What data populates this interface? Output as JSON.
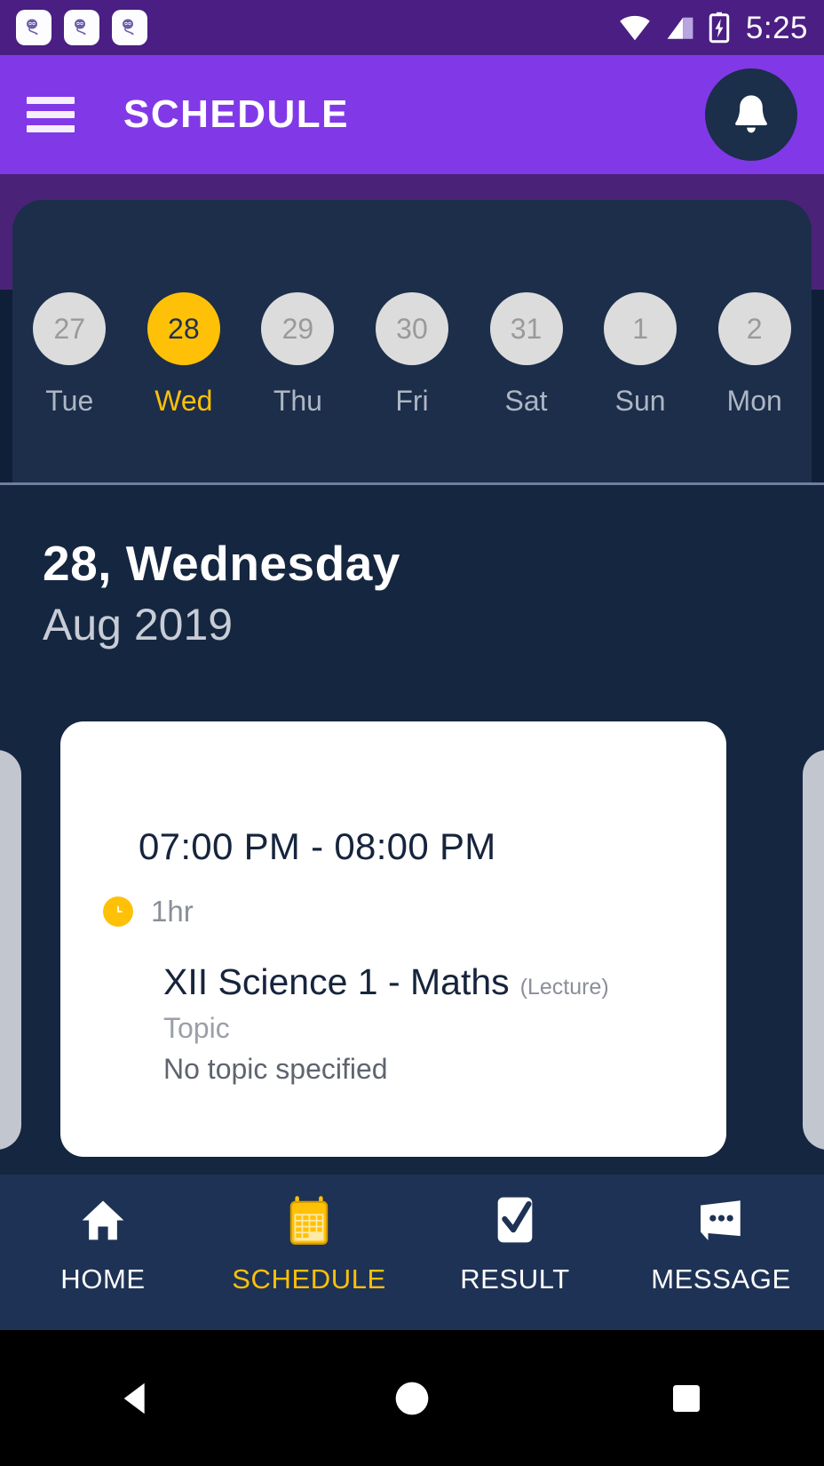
{
  "status_bar": {
    "time": "5:25",
    "notification_icons": [
      "app-notification-icon",
      "app-notification-icon",
      "app-notification-icon"
    ],
    "wifi_icon": "wifi-icon",
    "signal_icon": "cellular-signal-icon",
    "battery_icon": "battery-charging-icon",
    "background_color": "#4A1E83"
  },
  "app_bar": {
    "menu_icon": "hamburger-menu-icon",
    "title": "SCHEDULE",
    "notification_icon": "bell-icon",
    "background_color": "#8139E8"
  },
  "date_strip": {
    "days": [
      {
        "date": "27",
        "weekday": "Tue",
        "selected": false
      },
      {
        "date": "28",
        "weekday": "Wed",
        "selected": true
      },
      {
        "date": "29",
        "weekday": "Thu",
        "selected": false
      },
      {
        "date": "30",
        "weekday": "Fri",
        "selected": false
      },
      {
        "date": "31",
        "weekday": "Sat",
        "selected": false
      },
      {
        "date": "1",
        "weekday": "Sun",
        "selected": false
      },
      {
        "date": "2",
        "weekday": "Mon",
        "selected": false
      }
    ],
    "selected_color": "#FFC107",
    "inactive_circle_color": "#DCDCDC"
  },
  "heading": {
    "day_line": "28, Wednesday",
    "month_line": "Aug 2019"
  },
  "event_card": {
    "time_range": "07:00 PM - 08:00 PM",
    "duration_icon": "clock-icon",
    "duration": "1hr",
    "subject": "XII Science 1 - Maths",
    "session_type": "(Lecture)",
    "topic_label": "Topic",
    "topic_value": "No topic specified"
  },
  "bottom_nav": {
    "items": [
      {
        "label": "HOME",
        "icon": "home-icon",
        "active": false
      },
      {
        "label": "SCHEDULE",
        "icon": "calendar-icon",
        "active": true
      },
      {
        "label": "RESULT",
        "icon": "result-check-icon",
        "active": false
      },
      {
        "label": "MESSAGE",
        "icon": "message-icon",
        "active": false
      }
    ],
    "active_color": "#FFC107",
    "background_color": "#1E3255"
  },
  "system_nav": {
    "back_icon": "back-triangle-icon",
    "home_icon": "home-circle-icon",
    "recents_icon": "recents-square-icon"
  }
}
